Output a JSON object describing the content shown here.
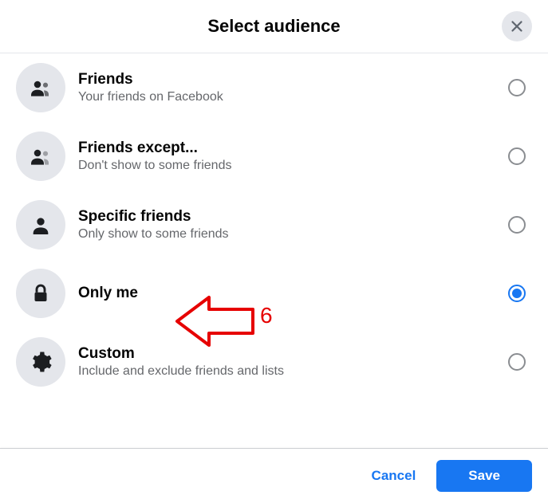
{
  "header": {
    "title": "Select audience"
  },
  "options": [
    {
      "icon": "friends",
      "title": "Friends",
      "subtitle": "Your friends on Facebook",
      "selected": false
    },
    {
      "icon": "friends-except",
      "title": "Friends except...",
      "subtitle": "Don't show to some friends",
      "selected": false
    },
    {
      "icon": "specific-friends",
      "title": "Specific friends",
      "subtitle": "Only show to some friends",
      "selected": false
    },
    {
      "icon": "lock",
      "title": "Only me",
      "subtitle": "",
      "selected": true
    },
    {
      "icon": "gear",
      "title": "Custom",
      "subtitle": "Include and exclude friends and lists",
      "selected": false
    }
  ],
  "footer": {
    "cancel_label": "Cancel",
    "save_label": "Save"
  },
  "annotation": {
    "label": "6"
  }
}
